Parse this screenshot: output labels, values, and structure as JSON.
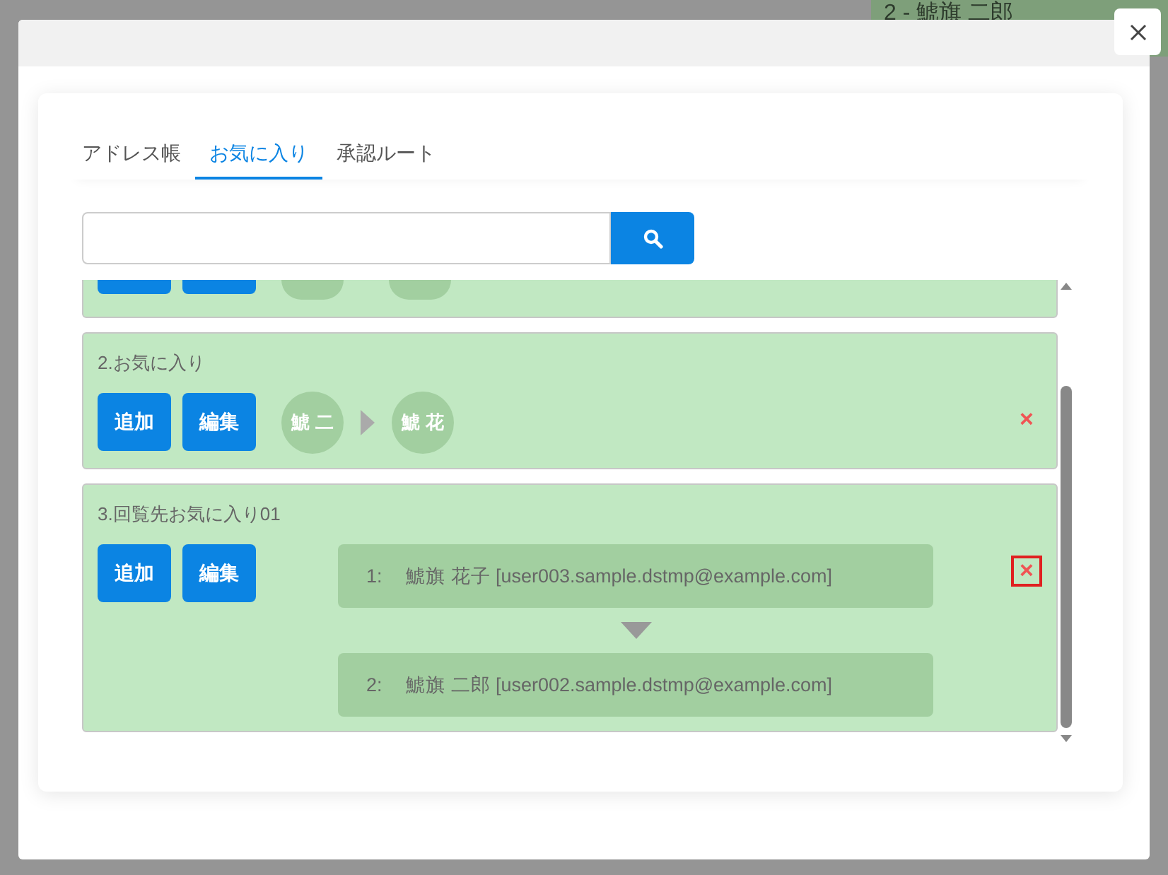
{
  "background": {
    "header_text": "2 - 鯱旗 二郎"
  },
  "tabs": [
    {
      "label": "アドレス帳",
      "selected": false
    },
    {
      "label": "お気に入り",
      "selected": true
    },
    {
      "label": "承認ルート",
      "selected": false
    }
  ],
  "favorites": [
    {
      "kind": "cut-off"
    },
    {
      "kind": "compact",
      "title": "2.お気に入り",
      "add_label": "追加",
      "edit_label": "編集",
      "delete_label": "×",
      "delete_focused": false,
      "members": [
        {
          "initials": "鯱 二"
        },
        {
          "initials": "鯱 花"
        }
      ]
    },
    {
      "kind": "list",
      "title": "3.回覧先お気に入り01",
      "add_label": "追加",
      "edit_label": "編集",
      "delete_label": "×",
      "delete_focused": true,
      "members": [
        {
          "index": "1:",
          "name": "鯱旗 花子 [user003.sample.dstmp@example.com]"
        },
        {
          "index": "2:",
          "name": "鯱旗 二郎 [user002.sample.dstmp@example.com]"
        }
      ]
    }
  ]
}
